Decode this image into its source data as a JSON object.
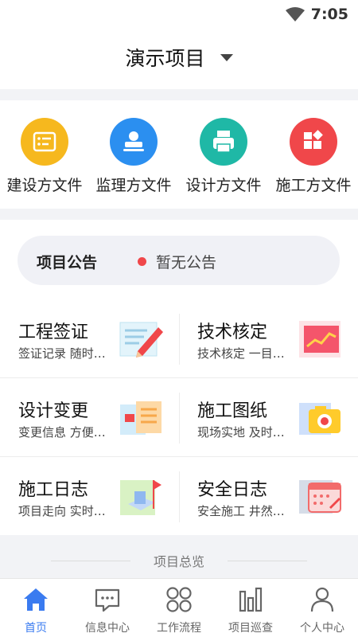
{
  "status": {
    "time": "7:05"
  },
  "header": {
    "project_title": "演示项目"
  },
  "categories": [
    {
      "label": "建设方文件",
      "icon": "checklist-icon",
      "color": "#f6b81e"
    },
    {
      "label": "监理方文件",
      "icon": "stamp-icon",
      "color": "#2b8ff0"
    },
    {
      "label": "设计方文件",
      "icon": "printer-icon",
      "color": "#1fb8a6"
    },
    {
      "label": "施工方文件",
      "icon": "blocks-icon",
      "color": "#f0474a"
    }
  ],
  "notice": {
    "label": "项目公告",
    "text": "暂无公告"
  },
  "cards": [
    {
      "title": "工程签证",
      "subtitle": "签证记录 随时…",
      "icon": "pencil-note-icon"
    },
    {
      "title": "技术核定",
      "subtitle": "技术核定 一目…",
      "icon": "line-chart-icon"
    },
    {
      "title": "设计变更",
      "subtitle": "变更信息 方便…",
      "icon": "documents-icon"
    },
    {
      "title": "施工图纸",
      "subtitle": "现场实地 及时…",
      "icon": "camera-icon"
    },
    {
      "title": "施工日志",
      "subtitle": "项目走向 实时…",
      "icon": "building-icon"
    },
    {
      "title": "安全日志",
      "subtitle": "安全施工 井然…",
      "icon": "calendar-icon"
    }
  ],
  "overview": {
    "label": "项目总览"
  },
  "tabs": [
    {
      "label": "首页",
      "icon": "home-icon",
      "active": true
    },
    {
      "label": "信息中心",
      "icon": "message-icon",
      "active": false
    },
    {
      "label": "工作流程",
      "icon": "workflow-icon",
      "active": false
    },
    {
      "label": "项目巡查",
      "icon": "bar-chart-icon",
      "active": false
    },
    {
      "label": "个人中心",
      "icon": "user-icon",
      "active": false
    }
  ],
  "colors": {
    "accent": "#3a7bf0",
    "notice_dot": "#f0474a"
  }
}
